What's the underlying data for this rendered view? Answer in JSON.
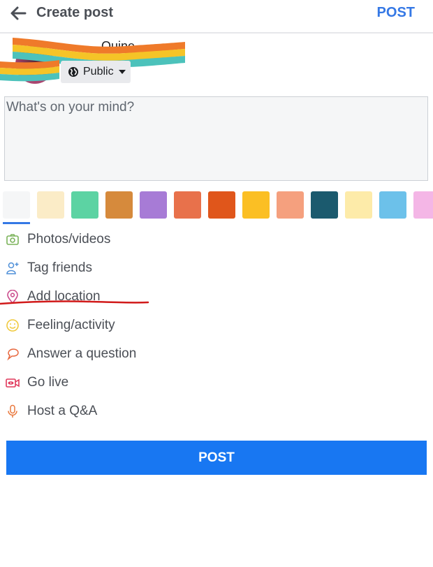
{
  "header": {
    "back_icon": "arrow-left-icon",
    "title": "Create post",
    "post_label": "POST"
  },
  "user": {
    "name_partial": "Quine",
    "name_redacted": true,
    "privacy": {
      "icon": "globe-icon",
      "label": "Public",
      "dropdown_icon": "caret-down-icon"
    }
  },
  "composer": {
    "value": "",
    "placeholder": "What's on your mind?"
  },
  "backgrounds": {
    "selected_index": 0,
    "swatches": [
      {
        "name": "plain",
        "color": "#f5f6f7"
      },
      {
        "name": "cream-pattern",
        "color": "#fbecc7"
      },
      {
        "name": "green",
        "color": "#5cd3a3"
      },
      {
        "name": "desert",
        "color": "#d68a3c"
      },
      {
        "name": "purple",
        "color": "#a77bd6"
      },
      {
        "name": "coral",
        "color": "#e8714b"
      },
      {
        "name": "orange-pattern",
        "color": "#e0561b"
      },
      {
        "name": "yellow-pattern",
        "color": "#fbbf24"
      },
      {
        "name": "peach-pattern",
        "color": "#f5a07e"
      },
      {
        "name": "teal-pattern",
        "color": "#1b5a6e"
      },
      {
        "name": "light-yellow",
        "color": "#fdeba9"
      },
      {
        "name": "sky-pattern",
        "color": "#6cc1ea"
      },
      {
        "name": "pink-pattern",
        "color": "#f4b6e6"
      }
    ]
  },
  "actions": [
    {
      "id": "photos",
      "label": "Photos/videos",
      "icon": "camera-icon",
      "color": "#7bb35a"
    },
    {
      "id": "tag",
      "label": "Tag friends",
      "icon": "tag-friends-icon",
      "color": "#4e8fd8"
    },
    {
      "id": "location",
      "label": "Add location",
      "icon": "location-pin-icon",
      "color": "#cc4f8f"
    },
    {
      "id": "feeling",
      "label": "Feeling/activity",
      "icon": "smiley-icon",
      "color": "#f0c93d"
    },
    {
      "id": "question",
      "label": "Answer a question",
      "icon": "speech-bubble-icon",
      "color": "#e7683f"
    },
    {
      "id": "live",
      "label": "Go live",
      "icon": "live-video-icon",
      "color": "#e0395c"
    },
    {
      "id": "qa",
      "label": "Host a Q&A",
      "icon": "microphone-icon",
      "color": "#e9793e"
    }
  ],
  "annotation": {
    "underlined_item": "Add location",
    "color": "#d11a1a"
  },
  "footer": {
    "post_label": "POST",
    "color": "#1877f2"
  }
}
